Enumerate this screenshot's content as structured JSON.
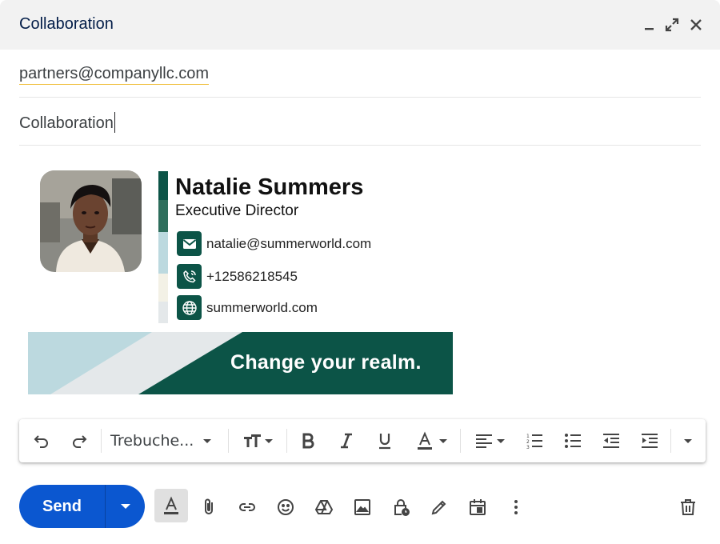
{
  "window": {
    "title": "Collaboration",
    "controls": [
      "minimize-icon",
      "fullscreen-icon",
      "close-icon"
    ]
  },
  "compose": {
    "to": "partners@companyllc.com",
    "subject": "Collaboration"
  },
  "signature": {
    "name": "Natalie Summers",
    "title": "Executive Director",
    "email": "natalie@summerworld.com",
    "phone": "+12586218545",
    "website": "summerworld.com",
    "banner_text": "Change your realm.",
    "colors": {
      "brand_dark": "#0c5447",
      "brand_mid": "#2e6e5c",
      "brand_light": "#bcd9df",
      "brand_cream": "#f3f1e6",
      "brand_grey": "#e4e8ea"
    }
  },
  "toolbar": {
    "font_name": "Trebuche...",
    "items": [
      "undo-icon",
      "redo-icon",
      "font-select",
      "text-size-icon",
      "bold-icon",
      "italic-icon",
      "underline-icon",
      "text-color-icon",
      "align-icon",
      "numbered-list-icon",
      "bulleted-list-icon",
      "indent-less-icon",
      "indent-more-icon",
      "more-formatting-icon"
    ]
  },
  "actions": {
    "send_label": "Send",
    "bottom_icons": [
      "formatting-icon",
      "attach-icon",
      "link-icon",
      "emoji-icon",
      "drive-icon",
      "photo-icon",
      "confidential-icon",
      "signature-icon",
      "schedule-icon",
      "more-options-icon",
      "discard-icon"
    ],
    "accent_color": "#0b57d0"
  }
}
